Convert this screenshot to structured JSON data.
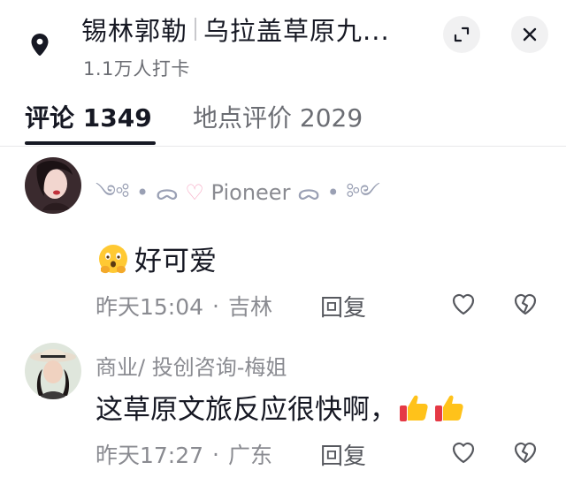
{
  "header": {
    "location_name": "锡林郭勒",
    "location_sub": "乌拉盖草原九...",
    "checkins": "1.1万人打卡",
    "icons": {
      "pin": "location-pin-icon",
      "expand": "expand-icon",
      "close": "close-icon"
    }
  },
  "tabs": [
    {
      "label": "评论 1349",
      "active": true
    },
    {
      "label": "地点评价 2029",
      "active": false
    }
  ],
  "comments": [
    {
      "username": "Pioneer",
      "text": "好可爱",
      "emoji": "thinking-face",
      "time": "昨天15:04",
      "location": "吉林",
      "reply": "回复"
    },
    {
      "username": "商业/ 投创咨询-梅姐",
      "text": "这草原文旅反应很快啊，",
      "emoji": "thumbs-up",
      "time": "昨天17:27",
      "location": "广东",
      "reply": "回复"
    }
  ],
  "colors": {
    "accent": "#161823",
    "muted": "#8a8b91",
    "divider": "#e8e8ea"
  }
}
